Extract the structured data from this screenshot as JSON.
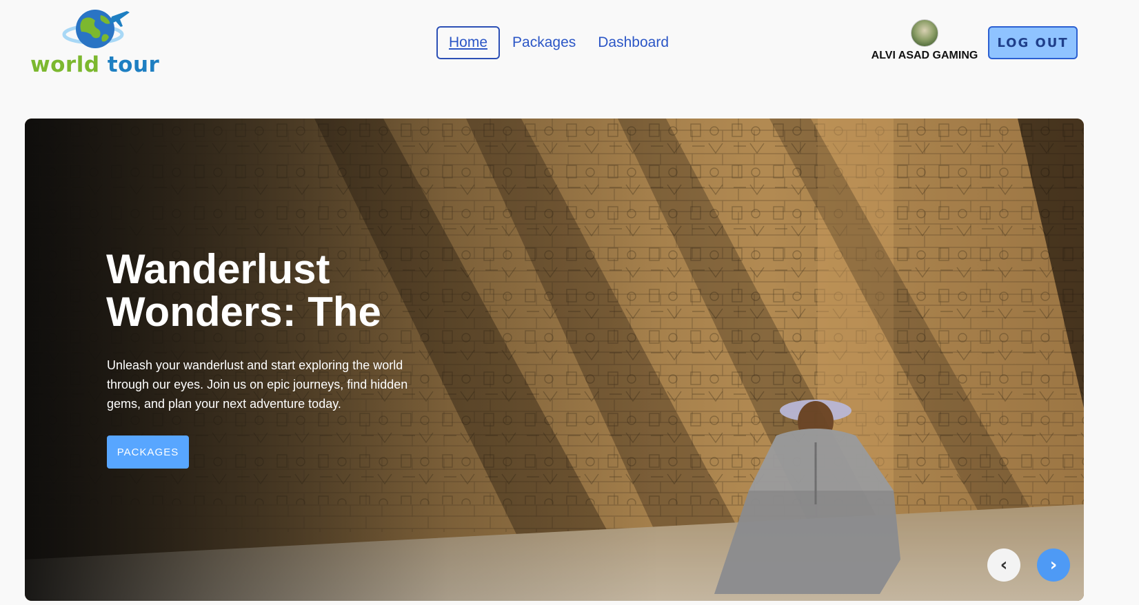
{
  "brand": {
    "name_part1": "world",
    "name_part2": "tour"
  },
  "nav": {
    "items": [
      {
        "label": "Home",
        "active": true
      },
      {
        "label": "Packages",
        "active": false
      },
      {
        "label": "Dashboard",
        "active": false
      }
    ]
  },
  "user": {
    "name": "ALVI ASAD GAMING"
  },
  "header": {
    "logout_label": "LOG OUT"
  },
  "hero": {
    "title": "Wanderlust Wonders: The",
    "description": "Unleash your wanderlust and start exploring the world through our eyes. Join us on epic journeys, find hidden gems, and plan your next adventure today.",
    "cta_label": "PACKAGES",
    "prev_icon": "‹",
    "next_icon": "›"
  },
  "colors": {
    "brand_green": "#7cb82f",
    "brand_blue": "#1e7fc2",
    "nav_link": "#2b56c6",
    "logout_bg": "#8fc3ff",
    "cta_bg": "#58a6ff",
    "next_btn_bg": "#4e9af5"
  }
}
